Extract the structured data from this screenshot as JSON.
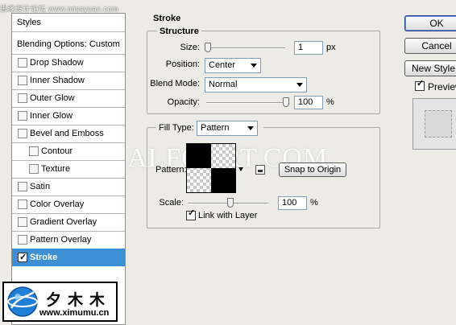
{
  "watermark": {
    "top": "思缘设计论坛 www.missyuan.com",
    "center": "ALFOART.COM"
  },
  "styles_panel": {
    "header": "Styles",
    "blending": "Blending Options: Custom",
    "items": [
      {
        "label": "Drop Shadow",
        "checked": false
      },
      {
        "label": "Inner Shadow",
        "checked": false
      },
      {
        "label": "Outer Glow",
        "checked": false
      },
      {
        "label": "Inner Glow",
        "checked": false
      },
      {
        "label": "Bevel and Emboss",
        "checked": false
      },
      {
        "label": "Contour",
        "checked": false,
        "sub": true
      },
      {
        "label": "Texture",
        "checked": false,
        "sub": true
      },
      {
        "label": "Satin",
        "checked": false
      },
      {
        "label": "Color Overlay",
        "checked": false
      },
      {
        "label": "Gradient Overlay",
        "checked": false
      },
      {
        "label": "Pattern Overlay",
        "checked": false
      },
      {
        "label": "Stroke",
        "checked": true,
        "active": true
      }
    ]
  },
  "stroke": {
    "title": "Stroke",
    "structure_title": "Structure",
    "size_label": "Size:",
    "size_value": "1",
    "size_unit": "px",
    "position_label": "Position:",
    "position_value": "Center",
    "blend_mode_label": "Blend Mode:",
    "blend_mode_value": "Normal",
    "opacity_label": "Opacity:",
    "opacity_value": "100",
    "opacity_unit": "%",
    "fill_type_label": "Fill Type:",
    "fill_type_value": "Pattern",
    "pattern_label": "Pattern:",
    "snap_to_origin": "Snap to Origin",
    "scale_label": "Scale:",
    "scale_value": "100",
    "scale_unit": "%",
    "link_with_layer": "Link with Layer",
    "link_with_layer_checked": true
  },
  "buttons": {
    "ok": "OK",
    "cancel": "Cancel",
    "new_style": "New Style...",
    "preview": "Preview",
    "preview_checked": true
  },
  "logo": {
    "chinese": "夕木木",
    "url": "www.ximumu.cn"
  }
}
